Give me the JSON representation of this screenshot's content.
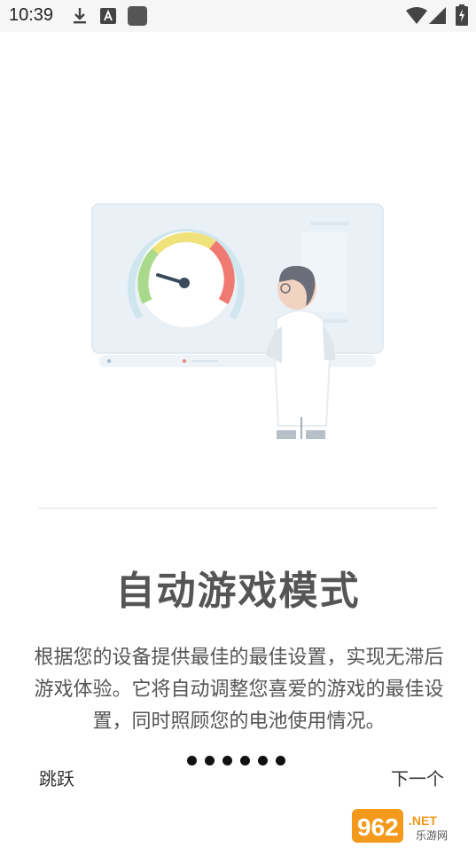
{
  "status_bar": {
    "time": "10:39",
    "icons_left": [
      "download-icon",
      "text-a-icon",
      "app-square-icon"
    ],
    "icons_right": [
      "wifi-icon",
      "cellular-signal-icon",
      "battery-charging-icon"
    ]
  },
  "onboarding": {
    "title": "自动游戏模式",
    "description": "根据您的设备提供最佳的最佳设置，实现无滞后游戏体验。它将自动调整您喜爱的游戏的最佳设置，同时照顾您的电池使用情况。",
    "skip_label": "跳跃",
    "next_label": "下一个",
    "page_dots": 6
  },
  "watermark": {
    "brand": "962",
    "tld": ".NET",
    "caption": "乐游网"
  },
  "colors": {
    "accent_gauge_red": "#ef7a72",
    "accent_gauge_yellow": "#f0e27a",
    "accent_gauge_green": "#a9d98a",
    "panel_bg": "#e9f0f6",
    "watermark_orange": "#f39a1c"
  }
}
